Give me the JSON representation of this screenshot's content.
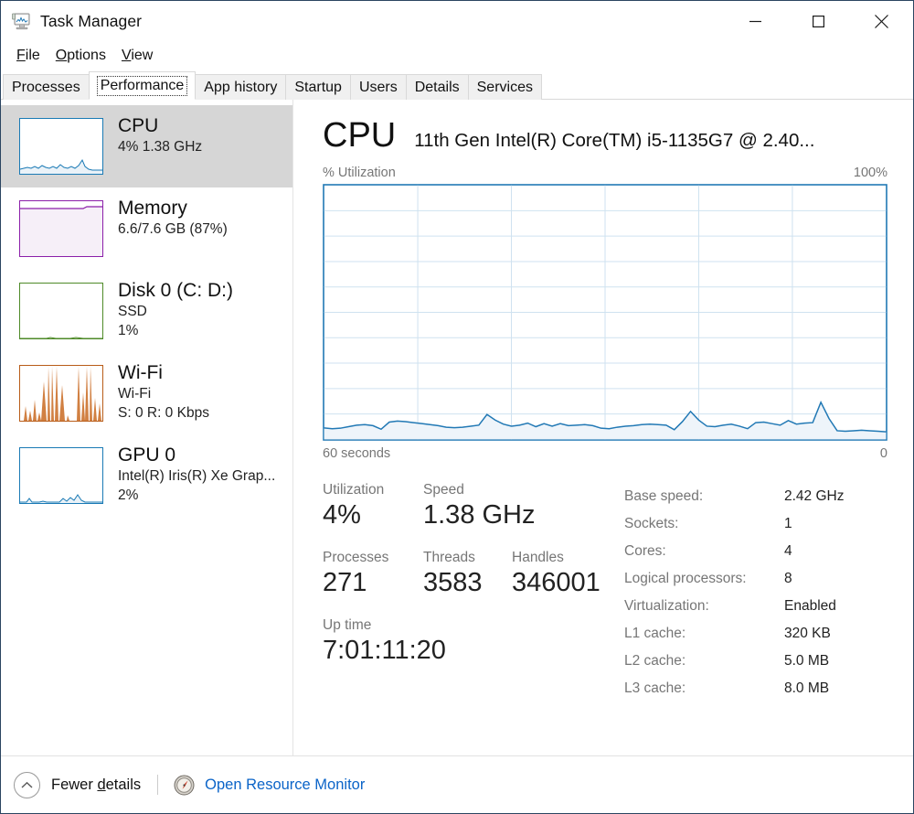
{
  "window": {
    "title": "Task Manager",
    "icon": "task-manager-icon",
    "controls": {
      "minimize": "minimize",
      "maximize": "maximize",
      "close": "close"
    }
  },
  "menu": [
    {
      "label": "File",
      "accel": "F"
    },
    {
      "label": "Options",
      "accel": "O"
    },
    {
      "label": "View",
      "accel": "V"
    }
  ],
  "tabs": [
    {
      "label": "Processes",
      "selected": false
    },
    {
      "label": "Performance",
      "selected": true
    },
    {
      "label": "App history",
      "selected": false
    },
    {
      "label": "Startup",
      "selected": false
    },
    {
      "label": "Users",
      "selected": false
    },
    {
      "label": "Details",
      "selected": false
    },
    {
      "label": "Services",
      "selected": false
    }
  ],
  "sidebar": {
    "items": [
      {
        "name": "CPU",
        "line1": "4%  1.38 GHz",
        "line2": "",
        "selected": true,
        "color": "#1a7ab5",
        "graph": "cpu"
      },
      {
        "name": "Memory",
        "line1": "6.6/7.6 GB (87%)",
        "line2": "",
        "selected": false,
        "color": "#8b1fa9",
        "graph": "memory"
      },
      {
        "name": "Disk 0 (C: D:)",
        "line1": "SSD",
        "line2": "1%",
        "selected": false,
        "color": "#4e8a28",
        "graph": "disk"
      },
      {
        "name": "Wi-Fi",
        "line1": "Wi-Fi",
        "line2": "S: 0 R: 0 Kbps",
        "selected": false,
        "color": "#b85c18",
        "graph": "wifi"
      },
      {
        "name": "GPU 0",
        "line1": "Intel(R) Iris(R) Xe Grap...",
        "line2": "2%",
        "selected": false,
        "color": "#1a7ab5",
        "graph": "gpu"
      }
    ]
  },
  "main": {
    "title": "CPU",
    "model": "11th Gen Intel(R) Core(TM) i5-1135G7 @ 2.40...",
    "graph_top_left": "% Utilization",
    "graph_top_right": "100%",
    "graph_bottom_left": "60 seconds",
    "graph_bottom_right": "0",
    "stats": [
      [
        {
          "label": "Utilization",
          "value": "4%"
        },
        {
          "label": "Speed",
          "value": "1.38 GHz"
        }
      ],
      [
        {
          "label": "Processes",
          "value": "271"
        },
        {
          "label": "Threads",
          "value": "3583"
        },
        {
          "label": "Handles",
          "value": "346001"
        }
      ],
      [
        {
          "label": "Up time",
          "value": "7:01:11:20"
        }
      ]
    ],
    "specs": [
      {
        "key": "Base speed:",
        "value": "2.42 GHz"
      },
      {
        "key": "Sockets:",
        "value": "1"
      },
      {
        "key": "Cores:",
        "value": "4"
      },
      {
        "key": "Logical processors:",
        "value": "8"
      },
      {
        "key": "Virtualization:",
        "value": "Enabled"
      },
      {
        "key": "L1 cache:",
        "value": "320 KB"
      },
      {
        "key": "L2 cache:",
        "value": "5.0 MB"
      },
      {
        "key": "L3 cache:",
        "value": "8.0 MB"
      }
    ]
  },
  "statusbar": {
    "fewer_details": "Fewer details",
    "fewer_details_accel": "d",
    "chevron_icon": "chevron-up-icon",
    "resource_monitor": "Open Resource Monitor",
    "resource_monitor_icon": "resource-monitor-icon"
  },
  "chart_data": {
    "type": "area",
    "title": "% Utilization",
    "xlabel": "60 seconds",
    "ylabel": "% Utilization",
    "ylim": [
      0,
      100
    ],
    "xlim": [
      60,
      0
    ],
    "grid": true,
    "grid_cols": 6,
    "grid_rows": 10,
    "line_color": "#2279b5",
    "fill_color": "#eef4fa",
    "current_value": 4,
    "values": [
      4.5,
      4.2,
      4.4,
      5.0,
      5.6,
      5.8,
      5.4,
      4.0,
      6.8,
      7.2,
      7.0,
      6.6,
      6.2,
      5.8,
      5.4,
      4.8,
      4.6,
      4.8,
      5.2,
      5.6,
      9.8,
      7.6,
      6.0,
      5.2,
      5.6,
      6.4,
      5.0,
      6.2,
      5.2,
      6.2,
      5.4,
      5.6,
      5.8,
      5.4,
      4.4,
      4.2,
      4.8,
      5.2,
      5.4,
      5.8,
      6.0,
      5.8,
      5.6,
      3.8,
      7.0,
      11.0,
      7.6,
      5.2,
      5.0,
      5.6,
      6.0,
      5.2,
      4.2,
      6.6,
      6.8,
      6.2,
      5.6,
      7.4,
      6.0,
      6.4,
      6.6,
      14.6,
      8.2,
      3.4,
      3.2,
      3.4,
      3.6,
      3.4,
      3.2,
      3.0
    ]
  }
}
